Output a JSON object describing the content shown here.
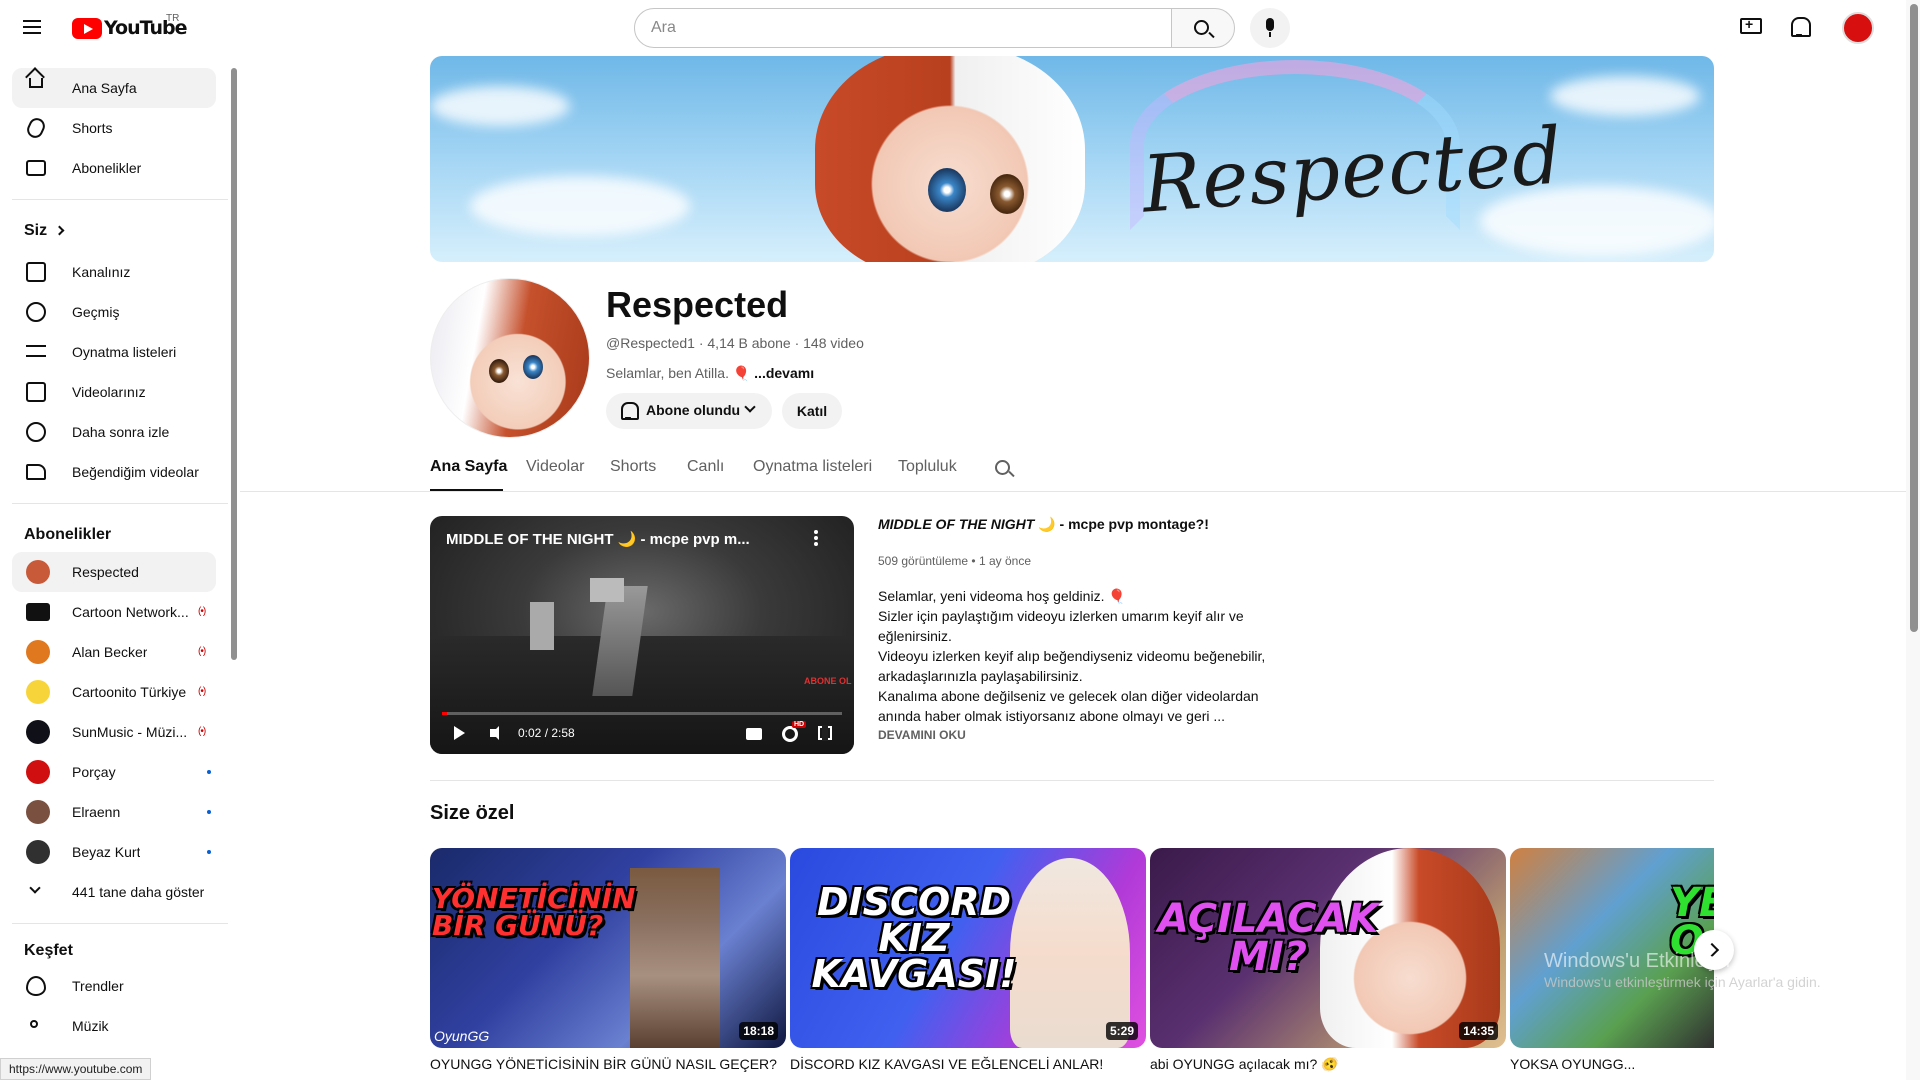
{
  "header": {
    "logo_text": "YouTube",
    "country_code": "TR",
    "search_placeholder": "Ara"
  },
  "sidebar": {
    "primary": [
      {
        "label": "Ana Sayfa",
        "icon": "home-icon"
      },
      {
        "label": "Shorts",
        "icon": "shorts-icon"
      },
      {
        "label": "Abonelikler",
        "icon": "subscriptions-icon"
      }
    ],
    "you_heading": "Siz",
    "you": [
      {
        "label": "Kanalınız",
        "icon": "your-channel-icon"
      },
      {
        "label": "Geçmiş",
        "icon": "history-icon"
      },
      {
        "label": "Oynatma listeleri",
        "icon": "playlists-icon"
      },
      {
        "label": "Videolarınız",
        "icon": "your-videos-icon"
      },
      {
        "label": "Daha sonra izle",
        "icon": "watch-later-icon"
      },
      {
        "label": "Beğendiğim videolar",
        "icon": "liked-icon"
      }
    ],
    "subs_heading": "Abonelikler",
    "subscriptions": [
      {
        "label": "Respected",
        "indicator": "",
        "color": "#c85a3a"
      },
      {
        "label": "Cartoon Network...",
        "indicator": "live",
        "color": "#111111"
      },
      {
        "label": "Alan Becker",
        "indicator": "live",
        "color": "#e07820"
      },
      {
        "label": "Cartoonito Türkiye",
        "indicator": "live",
        "color": "#f7d53a"
      },
      {
        "label": "SunMusic - Müzi...",
        "indicator": "live",
        "color": "#101018"
      },
      {
        "label": "Porçay",
        "indicator": "dot",
        "color": "#d01010"
      },
      {
        "label": "Elraenn",
        "indicator": "dot",
        "color": "#7a5040"
      },
      {
        "label": "Beyaz Kurt",
        "indicator": "dot",
        "color": "#303030"
      }
    ],
    "show_more": "441 tane daha göster",
    "explore_heading": "Keşfet",
    "explore": [
      {
        "label": "Trendler",
        "icon": "trending-icon"
      },
      {
        "label": "Müzik",
        "icon": "music-icon"
      }
    ],
    "status_url": "https://www.youtube.com"
  },
  "channel": {
    "banner_text": "Respected",
    "name": "Respected",
    "handle": "@Respected1",
    "subscribers": "4,14 B abone",
    "videos": "148 video",
    "description": "Selamlar, ben Atilla. 🎈",
    "more": "...devamı",
    "subscribed_label": "Abone olundu",
    "join_label": "Katıl"
  },
  "tabs": [
    "Ana Sayfa",
    "Videolar",
    "Shorts",
    "Canlı",
    "Oynatma listeleri",
    "Topluluk"
  ],
  "featured": {
    "player_title": "MIDDLE OF THE NIGHT 🌙 - mcpe pvp m...",
    "time": "0:02 / 2:58",
    "progress": 0.012,
    "watermark": "ABONE OL",
    "title_italic": "MIDDLE OF THE NIGHT",
    "title_rest": " 🌙 - mcpe pvp montage?!",
    "views": "509 görüntüleme",
    "age": "1 ay önce",
    "description": [
      "Selamlar, yeni videoma hoş geldiniz. 🎈",
      "Sizler için paylaştığım videoyu izlerken umarım keyif alır ve",
      "eğlenirsiniz.",
      "Videoyu izlerken keyif alıp beğendiyseniz videomu beğenebilir,",
      "arkadaşlarınızla paylaşabilirsiniz.",
      "Kanalıma abone değilseniz ve gelecek olan diğer videolardan",
      "anında haber olmak istiyorsanız abone olmayı ve geri ..."
    ],
    "read_more": "DEVAMINI OKU"
  },
  "section": {
    "title": "Size özel",
    "cards": [
      {
        "title": "OYUNGG YÖNETİCİSİNİN BİR GÜNÜ NASIL GEÇER?",
        "duration": "18:18",
        "thumb_text": "YÖNETİCİNİN BİR GÜNÜ?",
        "thumb_sig": "OyunGG"
      },
      {
        "title": "DİSCORD KIZ KAVGASI VE EĞLENCELİ ANLAR!",
        "duration": "5:29",
        "thumb_text": "DISCORD KIZ KAVGASI!"
      },
      {
        "title": "abi OYUNGG açılacak mı? 🫨",
        "duration": "14:35",
        "thumb_text": "AÇILACAK MI?"
      },
      {
        "title": "YOKSA OYUNGG...",
        "duration": "",
        "thumb_text": "YE O"
      }
    ]
  },
  "windows_watermark": {
    "line1": "Windows'u Etkinleştir",
    "line2": "Windows'u etkinleştirmek için Ayarlar'a gidin."
  }
}
